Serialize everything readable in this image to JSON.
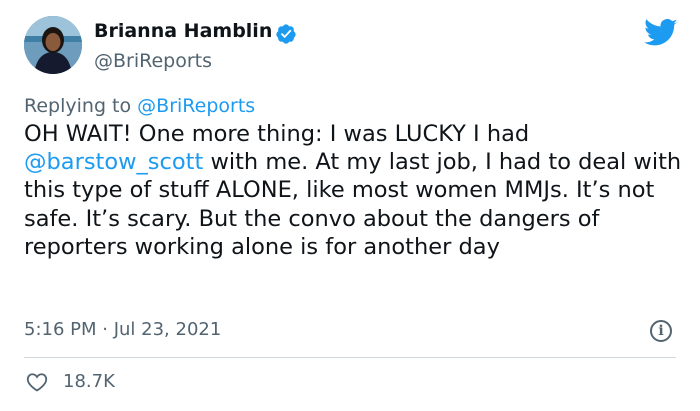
{
  "author": {
    "name": "Brianna Hamblin",
    "handle": "@BriReports",
    "verified_icon": "verified-badge-icon",
    "avatar": "avatar"
  },
  "header": {
    "platform_icon": "twitter-bird-icon",
    "brand_color": "#1d9bf0"
  },
  "reply": {
    "prefix": "Replying to ",
    "handle": "@BriReports"
  },
  "tweet": {
    "part1": "OH WAIT! One more thing: I was LUCKY I had ",
    "mention": "@barstow_scott",
    "part2": " with me. At my last job, I had to deal with this type of stuff ALONE, like most women MMJs. It’s not safe. It’s scary. But the convo about the dangers of reporters working alone is for another day"
  },
  "meta": {
    "time": "5:16 PM",
    "separator": " · ",
    "date": "Jul 23, 2021",
    "info_icon": "info-icon"
  },
  "actions": {
    "like_icon": "heart-icon",
    "like_count": "18.7K"
  },
  "colors": {
    "text": "#0f1419",
    "secondary": "#536471",
    "link": "#1d9bf0",
    "divider": "#cfd9de"
  }
}
